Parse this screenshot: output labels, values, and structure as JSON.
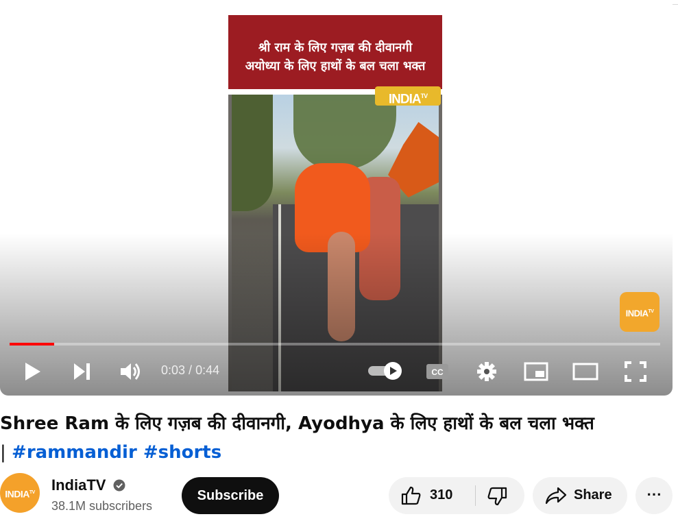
{
  "video": {
    "banner_line1": "श्री राम के लिए गज़ब की दीवानगी",
    "banner_line2": "अयोध्या के लिए हाथों के बल चला भक्त",
    "badge_text": "INDIA",
    "badge_sup": "TV",
    "watermark_text": "INDIA",
    "watermark_sup": "TV"
  },
  "player": {
    "progress_fraction": 0.068,
    "time_current": "0:03",
    "time_sep": " / ",
    "time_total": "0:44",
    "icons": [
      "play-icon",
      "next-icon",
      "volume-icon",
      "autoplay-toggle",
      "cc-icon",
      "settings-icon",
      "miniplayer-icon",
      "theater-icon",
      "fullscreen-icon"
    ],
    "accent_color": "#ff0000"
  },
  "title": {
    "text": "Shree Ram के लिए गज़ब की दीवानगी, Ayodhya के लिए हाथों के बल चला भक्त",
    "sep": "| ",
    "hashtag1": "#rammandir",
    "hashtag2": "#shorts"
  },
  "channel": {
    "avatar_text": "INDIA",
    "avatar_sup": "TV",
    "name": "IndiaTV",
    "subscribers": "38.1M subscribers",
    "subscribe_label": "Subscribe"
  },
  "actions": {
    "likes": "310",
    "share_label": "Share",
    "more_label": "⋯"
  }
}
